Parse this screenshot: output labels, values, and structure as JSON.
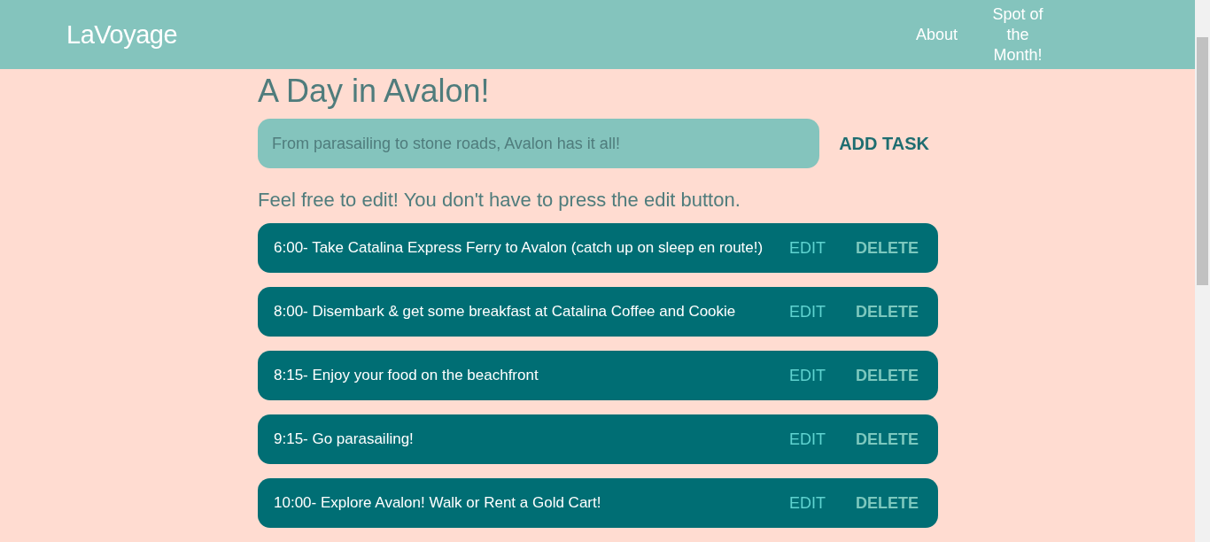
{
  "header": {
    "logo": "LaVoyage",
    "nav": [
      "About",
      "Spot of the Month!"
    ]
  },
  "title": "A Day in Avalon!",
  "task_input": {
    "placeholder": "From parasailing to stone roads, Avalon has it all!",
    "button": "ADD TASK"
  },
  "hint": "Feel free to edit! You don't have to press the edit button.",
  "tasks": [
    {
      "text": "6:00- Take Catalina Express Ferry to Avalon (catch up on sleep en route!)",
      "edit": "EDIT",
      "delete": "DELETE"
    },
    {
      "text": "8:00- Disembark & get some breakfast at Catalina Coffee and Cookie",
      "edit": "EDIT",
      "delete": "DELETE"
    },
    {
      "text": "8:15- Enjoy your food on the beachfront",
      "edit": "EDIT",
      "delete": "DELETE"
    },
    {
      "text": "9:15- Go parasailing!",
      "edit": "EDIT",
      "delete": "DELETE"
    },
    {
      "text": "10:00- Explore Avalon! Walk or Rent a Gold Cart!",
      "edit": "EDIT",
      "delete": "DELETE"
    }
  ]
}
